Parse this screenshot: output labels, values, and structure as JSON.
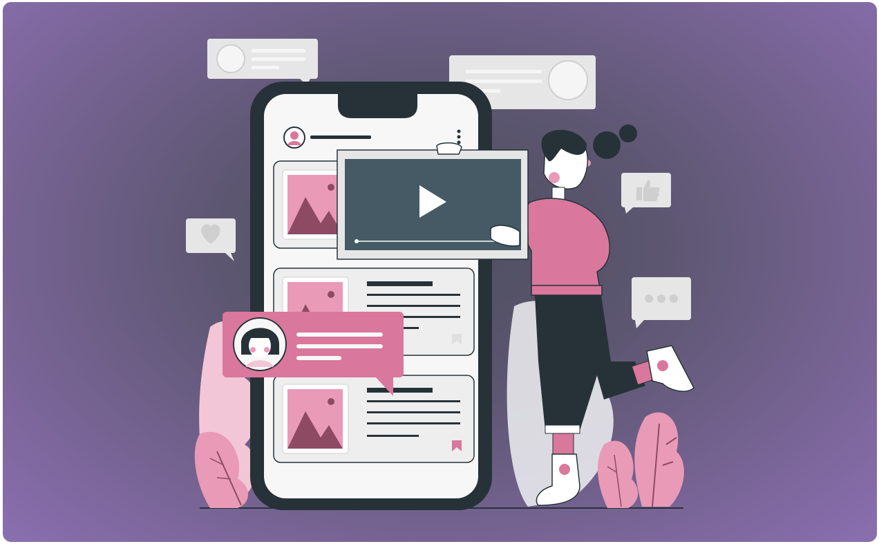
{
  "illustration": {
    "subject": "social-media-video-content",
    "colors": {
      "background_outer": "#8a6fb0",
      "background_inner": "#4f4f60",
      "phone_body": "#263238",
      "phone_screen": "#f7f7f7",
      "accent_pink": "#d9779c",
      "light_pink": "#f2c6d6",
      "dark_mauve": "#8f4a63",
      "bubble_grey": "#e6e6e6",
      "video_screen": "#455a64"
    },
    "icons": [
      "heart-icon",
      "thumbs-up-icon",
      "ellipsis-icon",
      "play-icon",
      "bookmark-icon",
      "avatar-icon",
      "image-placeholder-icon",
      "menu-dots-icon"
    ]
  }
}
